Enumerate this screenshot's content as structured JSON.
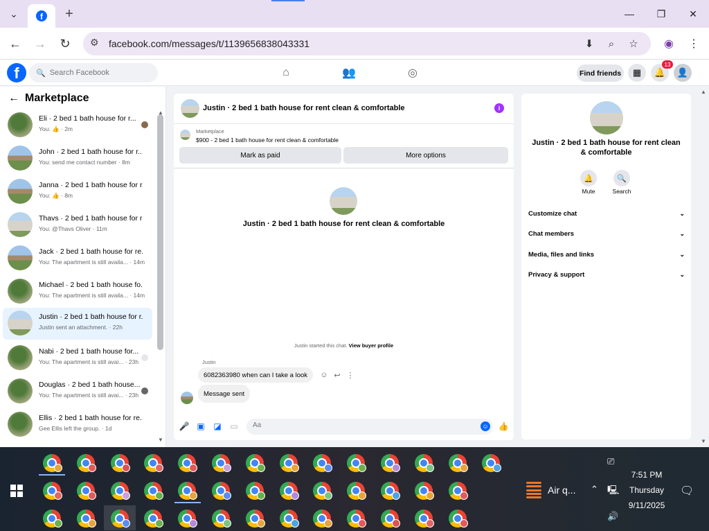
{
  "browser": {
    "url": "facebook.com/messages/t/1139656838043331"
  },
  "fb": {
    "search_placeholder": "Search Facebook",
    "find_friends": "Find friends",
    "notif_count": "13"
  },
  "sidebar": {
    "title": "Marketplace",
    "conversations": [
      {
        "name": "Eli · 2 bed 1 bath house for r...",
        "prev": "You: 👍 · 2m"
      },
      {
        "name": "John · 2 bed 1 bath house for r...",
        "prev": "You: send me contact number · 8m"
      },
      {
        "name": "Janna · 2 bed 1 bath house for r...",
        "prev": "You: 👍 · 8m"
      },
      {
        "name": "Thavs · 2 bed 1 bath house for r...",
        "prev": "You: @Thavs Oliver · 11m"
      },
      {
        "name": "Jack · 2 bed 1 bath house for re...",
        "prev": "You: The apartment is still availa... · 14m"
      },
      {
        "name": "Michael · 2 bed 1 bath house fo...",
        "prev": "You: The apartment is still availa... · 14m"
      },
      {
        "name": "Justin · 2 bed 1 bath house for r...",
        "prev": "Justin sent an attachment. · 22h"
      },
      {
        "name": "Nabi · 2 bed 1 bath house for...",
        "prev": "You: The apartment is still avai... · 23h"
      },
      {
        "name": "Douglas · 2 bed 1 bath house...",
        "prev": "You: The apartment is still avai... · 23h"
      },
      {
        "name": "Ellis · 2 bed 1 bath house for re...",
        "prev": "Gee Ellis left the group. · 1d"
      }
    ]
  },
  "chat": {
    "title": "Justin · 2 bed 1 bath house for rent clean & comfortable",
    "marketplace_label": "Marketplace",
    "listing": "$900 - 2 bed 1 bath house for rent clean & comfortable",
    "mark_paid": "Mark as paid",
    "more_options": "More options",
    "intro_name": "Justin · 2 bed 1 bath house for rent clean & comfortable",
    "started_text": "Justin started this chat.",
    "view_buyer": "View buyer profile",
    "sender": "Justin",
    "message": "6082363980 when can I take a look",
    "reply": "Message sent",
    "compose_placeholder": "Aa"
  },
  "panel": {
    "name": "Justin · 2 bed 1 bath house for rent clean & comfortable",
    "mute": "Mute",
    "search": "Search",
    "rows": [
      "Customize chat",
      "Chat members",
      "Media, files and links",
      "Privacy & support"
    ]
  },
  "taskbar": {
    "weather": "Air q...",
    "time": "7:51 PM",
    "day": "Thursday",
    "date": "9/11/2025"
  }
}
